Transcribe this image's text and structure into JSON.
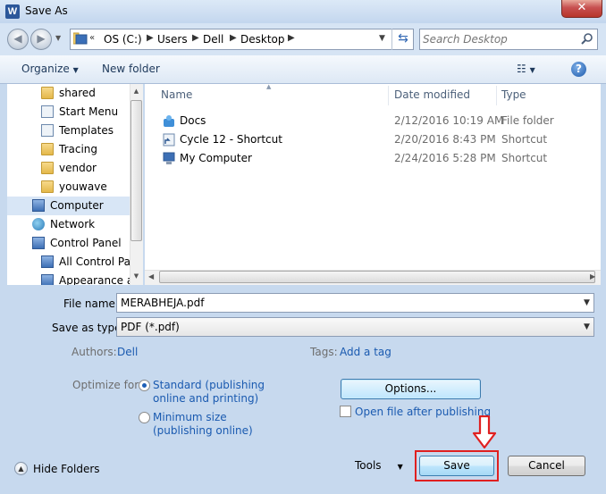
{
  "window": {
    "title": "Save As",
    "app_icon_letter": "W",
    "close_glyph": "✕"
  },
  "address": {
    "overflow": "«",
    "crumbs": [
      "OS (C:)",
      "Users",
      "Dell",
      "Desktop"
    ],
    "search_placeholder": "Search Desktop"
  },
  "toolbar": {
    "organize": "Organize",
    "new_folder": "New folder",
    "help": "?"
  },
  "nav": {
    "items": [
      {
        "label": "shared",
        "icon": "folder-icon"
      },
      {
        "label": "Start Menu",
        "icon": "shortcut-icon"
      },
      {
        "label": "Templates",
        "icon": "shortcut-icon"
      },
      {
        "label": "Tracing",
        "icon": "folder-icon"
      },
      {
        "label": "vendor",
        "icon": "folder-icon"
      },
      {
        "label": "youwave",
        "icon": "folder-icon"
      },
      {
        "label": "Computer",
        "icon": "computer-icon",
        "selected": true
      },
      {
        "label": "Network",
        "icon": "network-icon"
      },
      {
        "label": "Control Panel",
        "icon": "control-panel-icon"
      },
      {
        "label": "All Control Par",
        "icon": "control-panel-icon"
      },
      {
        "label": "Appearance ar",
        "icon": "control-panel-icon"
      }
    ]
  },
  "files": {
    "columns": {
      "name": "Name",
      "date": "Date modified",
      "type": "Type"
    },
    "rows": [
      {
        "name": "Docs",
        "date": "2/12/2016 10:19 AM",
        "type": "File folder"
      },
      {
        "name": "Cycle 12 - Shortcut",
        "date": "2/20/2016 8:43 PM",
        "type": "Shortcut"
      },
      {
        "name": "My Computer",
        "date": "2/24/2016 5:28 PM",
        "type": "Shortcut"
      }
    ]
  },
  "form": {
    "file_name_label": "File name:",
    "file_name_value": "MERABHEJA.pdf",
    "save_type_label": "Save as type:",
    "save_type_value": "PDF (*.pdf)",
    "authors_label": "Authors:",
    "authors_value": "Dell",
    "tags_label": "Tags:",
    "tags_value": "Add a tag",
    "optimize_label": "Optimize for:",
    "standard_line1": "Standard (publishing",
    "standard_line2": "online and printing)",
    "minimum_line1": "Minimum size",
    "minimum_line2": "(publishing online)",
    "options": "Options...",
    "open_after": "Open file after publishing"
  },
  "bottom": {
    "hide_folders": "Hide Folders",
    "tools": "Tools",
    "save": "Save",
    "cancel": "Cancel"
  },
  "colors": {
    "highlight": "#e02020",
    "accent": "#1a5ab0"
  }
}
